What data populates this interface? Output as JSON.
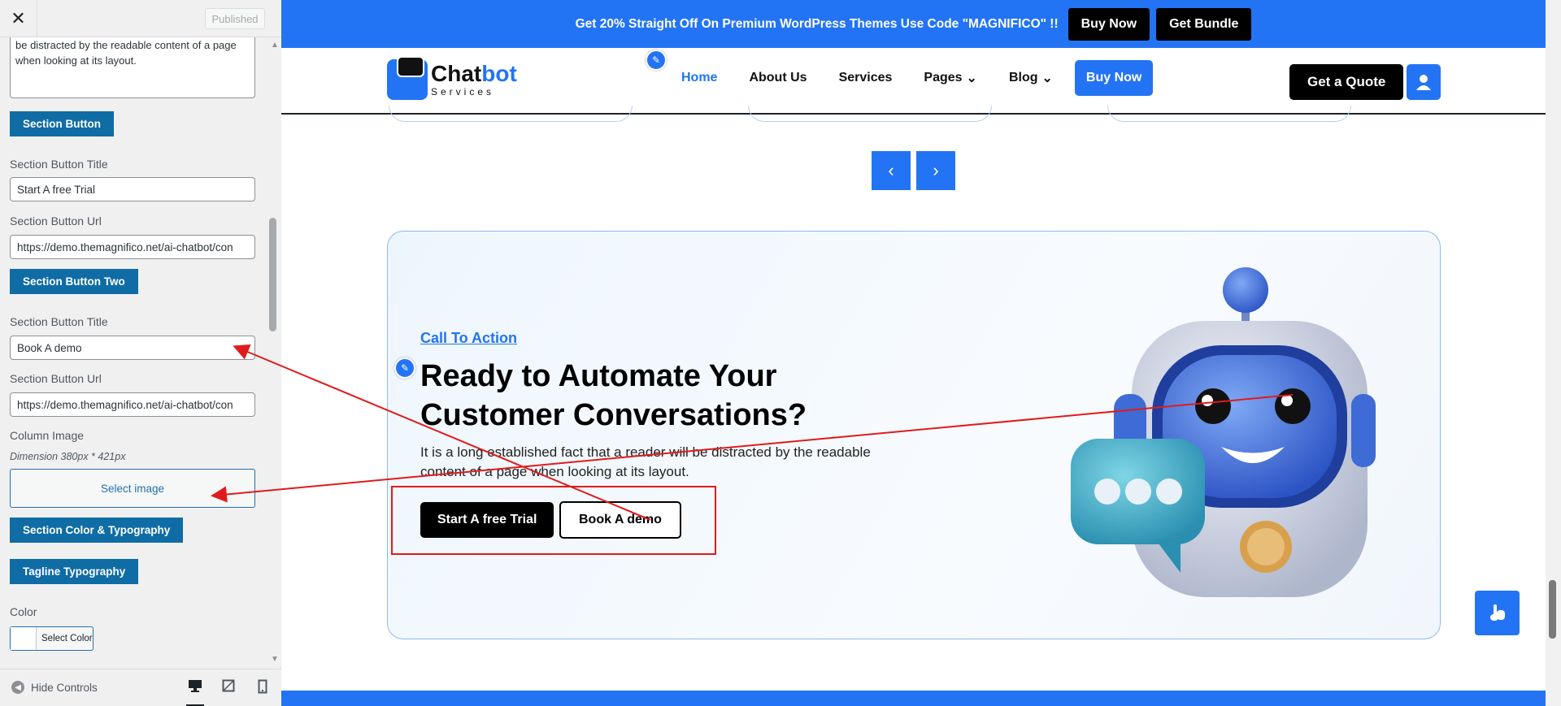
{
  "panel": {
    "close_label": "✕",
    "published_label": "Published",
    "textarea_text": "be distracted by the readable content of a page when looking at its layout.",
    "section_button_label": "Section Button",
    "btn1_title_label": "Section Button Title",
    "btn1_title_value": "Start A free Trial",
    "btn1_url_label": "Section Button Url",
    "btn1_url_value": "https://demo.themagnifico.net/ai-chatbot/con",
    "section_button_two_label": "Section Button Two",
    "btn2_title_label": "Section Button Title",
    "btn2_title_value": "Book A demo",
    "btn2_url_label": "Section Button Url",
    "btn2_url_value": "https://demo.themagnifico.net/ai-chatbot/con",
    "column_image_label": "Column Image",
    "dimension_text": "Dimension 380px * 421px",
    "select_image_label": "Select image",
    "color_typo_label": "Section Color & Typography",
    "tagline_typo_label": "Tagline Typography",
    "color_label": "Color",
    "select_color_label": "Select Color",
    "hide_controls_label": "Hide Controls"
  },
  "topbar": {
    "promo_text": "Get 20% Straight Off On Premium WordPress Themes Use Code \"MAGNIFICO\" !!",
    "buy_now": "Buy Now",
    "get_bundle": "Get Bundle"
  },
  "header": {
    "logo_main": "Chat",
    "logo_accent": "bot",
    "logo_sub": "Services",
    "nav": {
      "home": "Home",
      "about": "About Us",
      "services": "Services",
      "pages": "Pages",
      "blog": "Blog",
      "buy": "Buy Now"
    },
    "quote": "Get a Quote"
  },
  "cta": {
    "tag": "Call To Action",
    "title": "Ready to Automate Your Customer Conversations?",
    "desc": "It is a long established fact that a reader will be distracted by the readable content of a page when looking at its layout.",
    "button1": "Start A free Trial",
    "button2": "Book A demo"
  },
  "colors": {
    "accent": "#2374f4",
    "wp_blue": "#0f6ca5",
    "annotation_red": "#e01b1b"
  }
}
